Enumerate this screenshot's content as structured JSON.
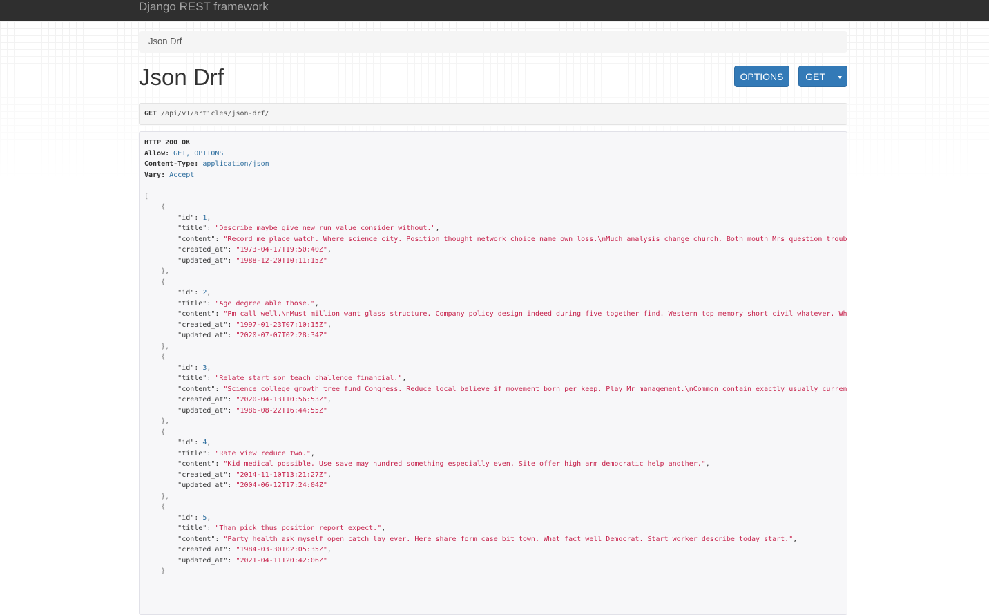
{
  "navbar": {
    "brand": "Django REST framework"
  },
  "breadcrumb": {
    "current": "Json Drf"
  },
  "page": {
    "title": "Json Drf"
  },
  "buttons": {
    "options": "OPTIONS",
    "get": "GET"
  },
  "request": {
    "method": "GET",
    "url": "/api/v1/articles/json-drf/"
  },
  "response": {
    "status": "HTTP 200 OK",
    "headers": [
      {
        "name": "Allow:",
        "value": "GET, OPTIONS"
      },
      {
        "name": "Content-Type:",
        "value": "application/json"
      },
      {
        "name": "Vary:",
        "value": "Accept"
      }
    ],
    "articles": [
      {
        "id": "1",
        "title": "\"Describe maybe give new run value consider without.\"",
        "content": "\"Record me place watch. Where science city. Position thought network choice name own loss.\\nMuch analysis change church. Both mouth Mrs question trouble.",
        "created_at": "\"1973-04-17T19:50:40Z\"",
        "updated_at": "\"1988-12-20T10:11:15Z\""
      },
      {
        "id": "2",
        "title": "\"Age degree able those.\"",
        "content": "\"Pm call well.\\nMust million want glass structure. Company policy design indeed during five together find. Western top memory short civil whatever. When",
        "created_at": "\"1997-01-23T07:10:15Z\"",
        "updated_at": "\"2020-07-07T02:28:34Z\""
      },
      {
        "id": "3",
        "title": "\"Relate start son teach challenge financial.\"",
        "content": "\"Science college growth tree fund Congress. Reduce local believe if movement born per keep. Play Mr management.\\nCommon contain exactly usually current.",
        "created_at": "\"2020-04-13T10:56:53Z\"",
        "updated_at": "\"1986-08-22T16:44:55Z\""
      },
      {
        "id": "4",
        "title": "\"Rate view reduce two.\"",
        "content": "\"Kid medical possible. Use save may hundred something especially even. Site offer high arm democratic help another.\"",
        "created_at": "\"2014-11-10T13:21:27Z\"",
        "updated_at": "\"2004-06-12T17:24:04Z\""
      },
      {
        "id": "5",
        "title": "\"Than pick thus position report expect.\"",
        "content": "\"Party health ask myself open catch lay ever. Here share form case bit town. What fact well Democrat. Start worker describe today start.\"",
        "created_at": "\"1984-03-30T02:05:35Z\"",
        "updated_at": "\"2021-04-11T20:42:06Z\""
      }
    ]
  }
}
